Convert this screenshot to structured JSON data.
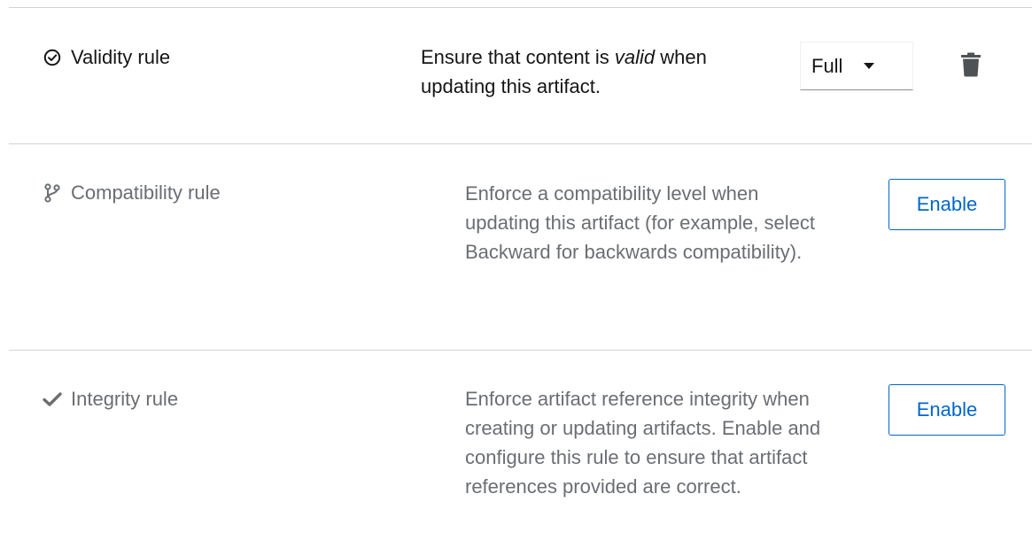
{
  "rules": [
    {
      "name": "Validity rule",
      "icon": "check-circle-icon",
      "description_before": "Ensure that content is ",
      "description_emphasis": "valid",
      "description_after": " when updating this artifact.",
      "enabled": true,
      "config_value": "Full"
    },
    {
      "name": "Compatibility rule",
      "icon": "code-branch-icon",
      "description": "Enforce a compatibility level when updating this artifact (for example, select Backward for backwards compatibility).",
      "enabled": false,
      "action_label": "Enable"
    },
    {
      "name": "Integrity rule",
      "icon": "check-icon",
      "description": "Enforce artifact reference integrity when creating or updating artifacts. Enable and configure this rule to ensure that artifact references provided are correct.",
      "enabled": false,
      "action_label": "Enable"
    }
  ],
  "colors": {
    "accent": "#0066cc",
    "active_text": "#151515",
    "inactive_text": "#6a6e73",
    "divider": "#d2d2d2"
  }
}
